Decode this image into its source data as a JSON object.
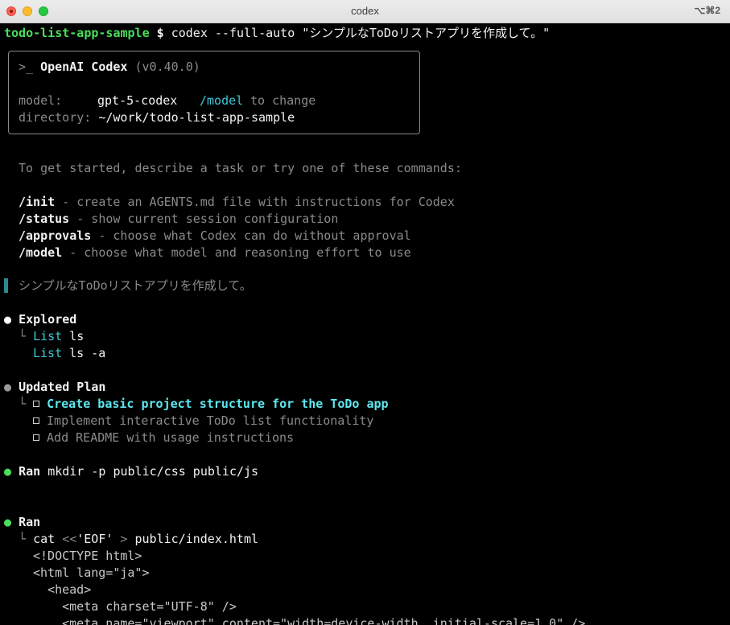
{
  "window": {
    "title": "codex",
    "shortcut": "⌥⌘2"
  },
  "prompt": {
    "dir": "todo-list-app-sample",
    "symbol": "$",
    "command": "codex --full-auto \"シンプルなToDoリストアプリを作成して。\""
  },
  "banner": {
    "prefix": ">_",
    "name": "OpenAI Codex",
    "version": "(v0.40.0)",
    "model_label": "model:",
    "model_value": "gpt-5-codex",
    "model_cmd": "/model",
    "model_hint": "to change",
    "dir_label": "directory:",
    "dir_value": "~/work/todo-list-app-sample"
  },
  "intro": "To get started, describe a task or try one of these commands:",
  "commands": [
    {
      "cmd": "/init",
      "desc": " - create an AGENTS.md file with instructions for Codex"
    },
    {
      "cmd": "/status",
      "desc": " - show current session configuration"
    },
    {
      "cmd": "/approvals",
      "desc": " - choose what Codex can do without approval"
    },
    {
      "cmd": "/model",
      "desc": " - choose what model and reasoning effort to use"
    }
  ],
  "user_message": "シンプルなToDoリストアプリを作成して。",
  "explored": {
    "bullet": "●",
    "title": "Explored",
    "branch": "└",
    "items": [
      {
        "verb": "List",
        "arg": "ls"
      },
      {
        "verb": "List",
        "arg": "ls -a"
      }
    ]
  },
  "plan": {
    "bullet": "●",
    "title": "Updated Plan",
    "branch": "└",
    "items": [
      {
        "text": "Create basic project structure for the ToDo app",
        "active": true
      },
      {
        "text": "Implement interactive ToDo list functionality",
        "active": false
      },
      {
        "text": "Add README with usage instructions",
        "active": false
      }
    ]
  },
  "ran1": {
    "bullet": "●",
    "title": "Ran",
    "command": "mkdir -p public/css public/js"
  },
  "ran2": {
    "bullet": "●",
    "title": "Ran",
    "branch": "└",
    "cmd_pre": "cat ",
    "cmd_op": "<<",
    "cmd_eof": "'EOF'",
    "cmd_redir": " > ",
    "cmd_file": "public/index.html",
    "html_lines": [
      "<!DOCTYPE html>",
      "<html lang=\"ja\">",
      "  <head>",
      "    <meta charset=\"UTF-8\" />",
      "    <meta name=\"viewport\" content=\"width=device-width, initial-scale=1.0\" />"
    ]
  }
}
